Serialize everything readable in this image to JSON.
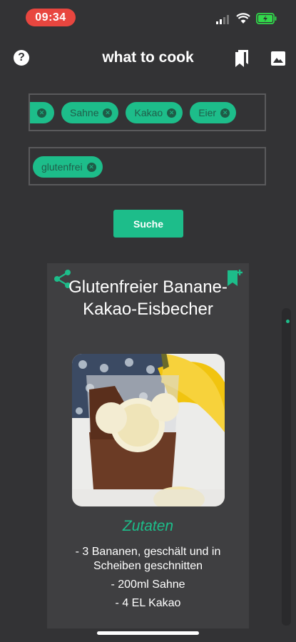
{
  "status_bar": {
    "time": "09:34"
  },
  "header": {
    "title": "what to cook",
    "help_glyph": "?"
  },
  "ingredient_chips": [
    {
      "label": ""
    },
    {
      "label": "Sahne"
    },
    {
      "label": "Kakao"
    },
    {
      "label": "Eier"
    }
  ],
  "filter_chips": [
    {
      "label": "glutenfrei"
    }
  ],
  "search_button": "Suche",
  "recipe": {
    "title": "Glutenfreier Banane-Kakao-Eisbecher",
    "ingredients_heading": "Zutaten",
    "ingredients": [
      "- 3 Bananen, geschält und in Scheiben geschnitten",
      "- 200ml Sahne",
      "- 4 EL Kakao"
    ]
  },
  "colors": {
    "accent": "#1dbd8a",
    "background": "#333335",
    "card": "#3f3f41",
    "time_pill": "#e8463f"
  },
  "icons": [
    "help-icon",
    "bookmarks-icon",
    "image-icon",
    "share-icon",
    "bookmark-add-icon",
    "signal-icon",
    "wifi-icon",
    "battery-icon"
  ]
}
